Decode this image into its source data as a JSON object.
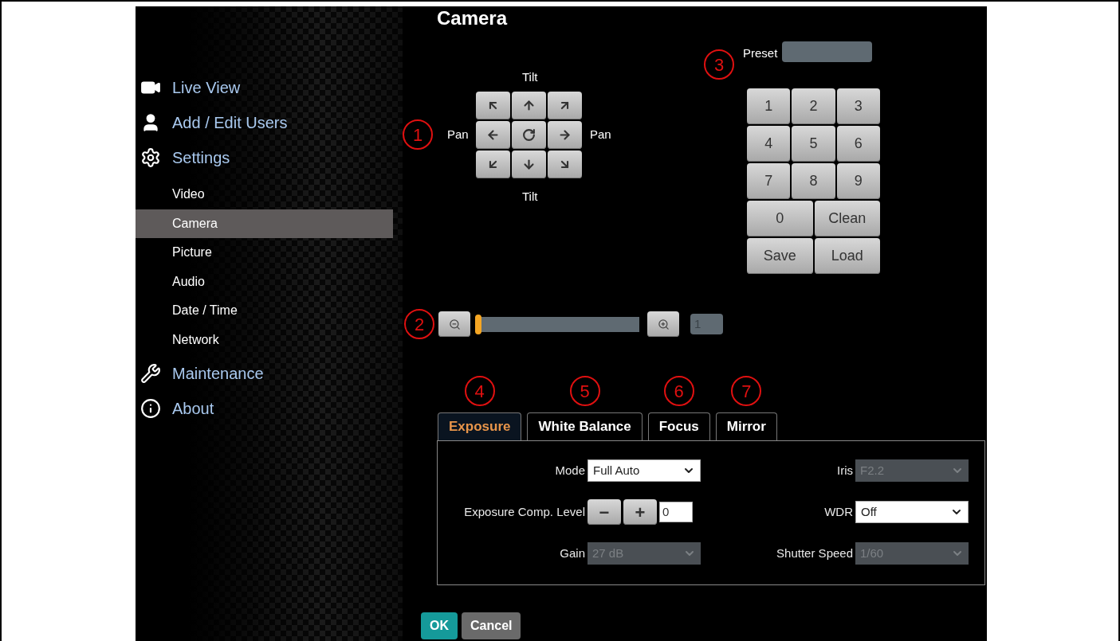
{
  "page": {
    "title": "Camera"
  },
  "sidebar": {
    "items": [
      {
        "label": "Live View"
      },
      {
        "label": "Add / Edit Users"
      },
      {
        "label": "Settings",
        "children": [
          {
            "label": "Video",
            "selected": false
          },
          {
            "label": "Camera",
            "selected": true
          },
          {
            "label": "Picture",
            "selected": false
          },
          {
            "label": "Audio",
            "selected": false
          },
          {
            "label": "Date / Time",
            "selected": false
          },
          {
            "label": "Network",
            "selected": false
          }
        ]
      },
      {
        "label": "Maintenance"
      },
      {
        "label": "About"
      }
    ]
  },
  "ptz": {
    "tilt_labels": [
      "Tilt",
      "Tilt"
    ],
    "pan_labels": [
      "Pan",
      "Pan"
    ]
  },
  "preset": {
    "label": "Preset",
    "keys": [
      "1",
      "2",
      "3",
      "4",
      "5",
      "6",
      "7",
      "8",
      "9"
    ],
    "wide_keys": [
      "0",
      "Clean",
      "Save",
      "Load"
    ]
  },
  "zoom": {
    "level": 0,
    "value": "1"
  },
  "annotations": [
    "1",
    "2",
    "3",
    "4",
    "5",
    "6",
    "7"
  ],
  "tabs": [
    {
      "label": "Exposure",
      "selected": true
    },
    {
      "label": "White Balance",
      "selected": false
    },
    {
      "label": "Focus",
      "selected": false
    },
    {
      "label": "Mirror",
      "selected": false
    }
  ],
  "exposure": {
    "fields": [
      {
        "kind": "select",
        "label": "Mode",
        "value": "Full Auto",
        "disabled": false
      },
      {
        "kind": "select",
        "label": "Iris",
        "value": "F2.2",
        "disabled": true
      },
      {
        "kind": "stepper",
        "label": "Exposure Comp. Level",
        "value": "0",
        "buttons": [
          "−",
          "+"
        ]
      },
      {
        "kind": "select",
        "label": "WDR",
        "value": "Off",
        "disabled": false
      },
      {
        "kind": "select",
        "label": "Gain",
        "value": "27 dB",
        "disabled": true
      },
      {
        "kind": "select",
        "label": "Shutter Speed",
        "value": "1/60",
        "disabled": true
      }
    ]
  },
  "buttons": [
    {
      "kind": "primary",
      "label": "OK"
    },
    {
      "kind": "secondary",
      "label": "Cancel"
    }
  ]
}
